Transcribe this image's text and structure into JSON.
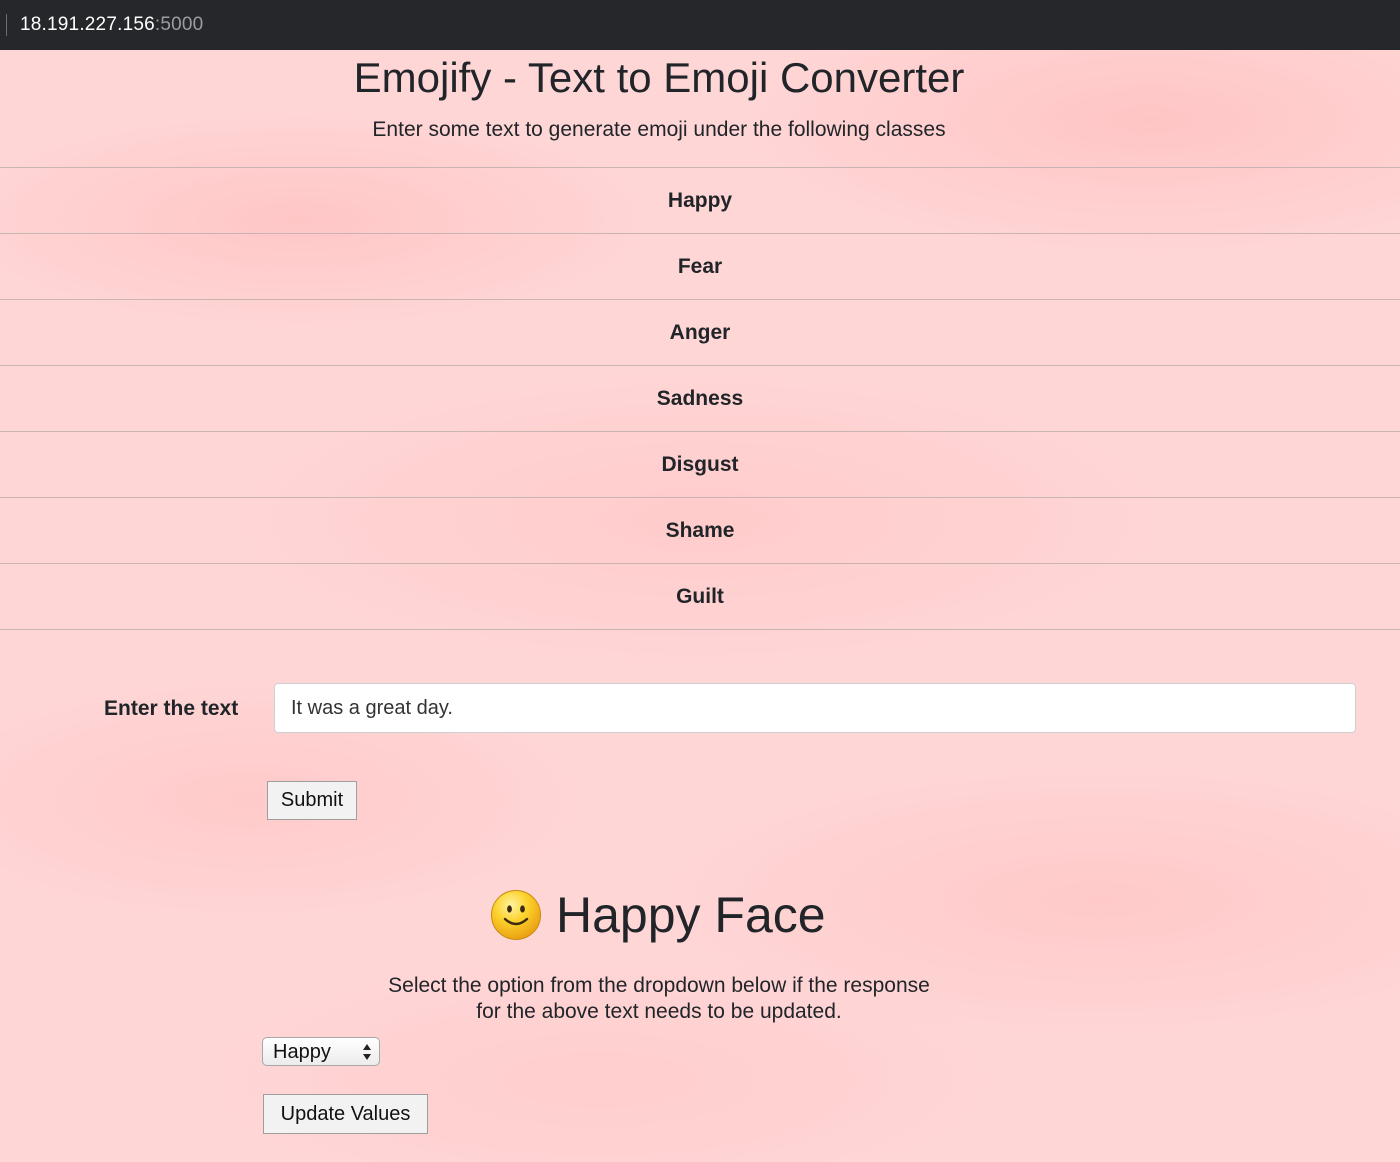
{
  "browser": {
    "url_host": "18.191.227.156",
    "url_port": ":5000"
  },
  "header": {
    "title": "Emojify - Text to Emoji Converter",
    "subtitle": "Enter some text to generate emoji under the following classes"
  },
  "classes": [
    "Happy",
    "Fear",
    "Anger",
    "Sadness",
    "Disgust",
    "Shame",
    "Guilt"
  ],
  "form": {
    "label": "Enter the text",
    "input_value": "It was a great day.",
    "submit_label": "Submit"
  },
  "result": {
    "emoji_icon": "smiley-face-icon",
    "title": "Happy Face",
    "instruction_line1": "Select the option from the dropdown below if the response",
    "instruction_line2": "for the above text needs to be updated.",
    "selected_option": "Happy",
    "update_label": "Update Values"
  },
  "colors": {
    "background": "#ffd6d6",
    "address_bar": "#26272b"
  }
}
